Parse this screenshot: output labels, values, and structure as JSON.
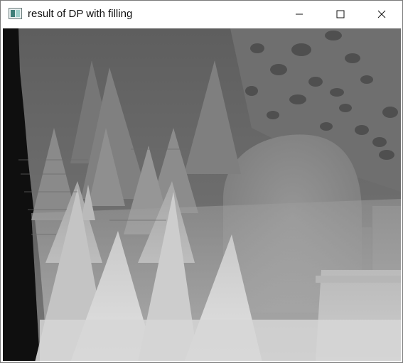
{
  "window": {
    "title": "result of DP with filling",
    "app_icon": "opencv-window-icon",
    "controls": [
      {
        "name": "minimize-button",
        "icon": "minimize-icon"
      },
      {
        "name": "maximize-button",
        "icon": "maximize-icon"
      },
      {
        "name": "close-button",
        "icon": "close-icon"
      }
    ]
  },
  "image": {
    "content": "grayscale disparity map"
  },
  "colors": {
    "titlebar_bg": "#ffffff",
    "title_text": "#111111",
    "frame_border": "#7a7a7a",
    "image_dark": "#101010",
    "image_light": "#d8d8d8"
  }
}
